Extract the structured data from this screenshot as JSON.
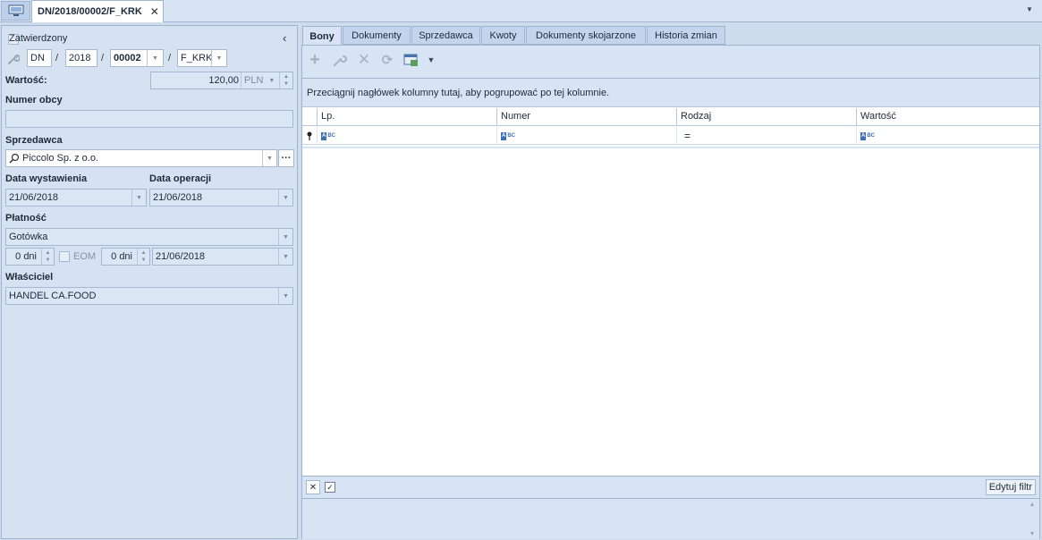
{
  "top": {
    "doc_tab_title": "DN/2018/00002/F_KRK",
    "close_glyph": "✕"
  },
  "left": {
    "approved_label": "Zatwierdzony",
    "doc_number": {
      "prefix": "DN",
      "year": "2018",
      "number": "00002",
      "series": "F_KRK",
      "separator": "/"
    },
    "value_label": "Wartość:",
    "value": "120,00",
    "currency": "PLN",
    "external_number_label": "Numer obcy",
    "external_number": "",
    "seller_label": "Sprzedawca",
    "seller": "Piccolo Sp. z o.o.",
    "issue_date_label": "Data wystawienia",
    "issue_date": "21/06/2018",
    "operation_date_label": "Data operacji",
    "operation_date": "21/06/2018",
    "payment_label": "Płatność",
    "payment_method": "Gotówka",
    "payment_days_1": "0 dni",
    "eom_label": "EOM",
    "payment_days_2": "0 dni",
    "payment_date": "21/06/2018",
    "owner_label": "Właściciel",
    "owner": "HANDEL CA.FOOD"
  },
  "tabs": [
    {
      "label": "Bony",
      "active": true
    },
    {
      "label": "Dokumenty",
      "active": false
    },
    {
      "label": "Sprzedawca",
      "active": false
    },
    {
      "label": "Kwoty",
      "active": false
    },
    {
      "label": "Dokumenty skojarzone",
      "active": false
    },
    {
      "label": "Historia zmian",
      "active": false
    }
  ],
  "toolbar": {
    "icons": [
      "add-icon",
      "edit-icon",
      "delete-icon",
      "refresh-icon",
      "export-icon"
    ]
  },
  "grid": {
    "group_hint": "Przeciągnij nagłówek kolumny tutaj, aby pogrupować po tej kolumnie.",
    "columns": [
      "Lp.",
      "Numer",
      "Rodzaj",
      "Wartość"
    ],
    "filter_abc": "ABC",
    "filter_eq": "="
  },
  "footer": {
    "edit_filter_label": "Edytuj filtr"
  },
  "colors": {
    "background": "#cfdced",
    "panel": "#d6e2f1",
    "border": "#9fb4cf",
    "active_tab_bg": "#d8e4f3"
  }
}
